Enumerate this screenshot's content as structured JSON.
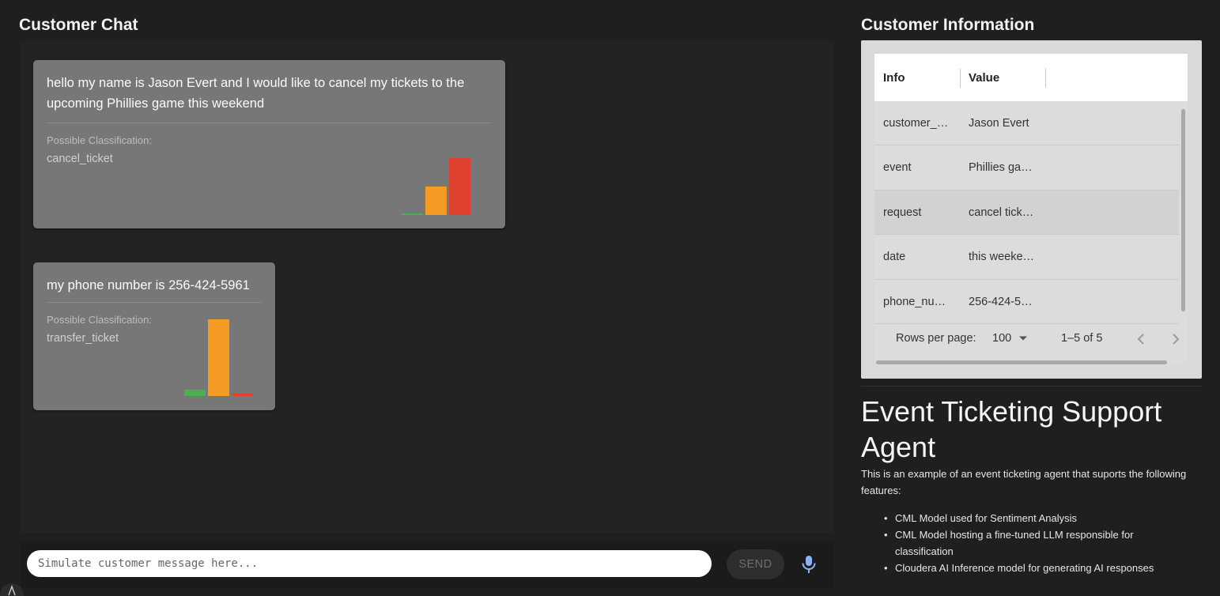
{
  "chat": {
    "title": "Customer Chat",
    "messages": [
      {
        "text": "hello my name is Jason Evert and I would like to cancel my tickets to the upcoming Phillies game this weekend",
        "classification_label": "Possible Classification:",
        "classification": "cancel_ticket",
        "sentiment": {
          "positive": 0.02,
          "neutral": 0.5,
          "negative": 1.0
        }
      },
      {
        "text": "my phone number is 256-424-5961",
        "classification_label": "Possible Classification:",
        "classification": "transfer_ticket",
        "sentiment": {
          "positive": 0.08,
          "neutral": 1.0,
          "negative": 0.03
        }
      }
    ],
    "composer": {
      "placeholder": "Simulate customer message here...",
      "send_label": "SEND",
      "mic_icon": "microphone-icon"
    }
  },
  "customer_info": {
    "title": "Customer Information",
    "columns": [
      "Info",
      "Value"
    ],
    "rows": [
      {
        "info": "customer_…",
        "value": "Jason Evert"
      },
      {
        "info": "event",
        "value": "Phillies ga…"
      },
      {
        "info": "request",
        "value": "cancel tick…"
      },
      {
        "info": "date",
        "value": "this weeke…"
      },
      {
        "info": "phone_nu…",
        "value": "256-424-5…"
      }
    ],
    "footer": {
      "rows_per_page_label": "Rows per page:",
      "rows_per_page_value": "100",
      "range": "1–5 of 5"
    }
  },
  "agent": {
    "title": "Event Ticketing Support Agent",
    "description": "This is an example of an event ticketing agent that suports the following features:",
    "features": [
      "CML Model used for Sentiment Analysis",
      "CML Model hosting a fine-tuned LLM responsible for classification",
      "Cloudera AI Inference model for generating AI responses"
    ]
  },
  "colors": {
    "positive": "#4caf50",
    "neutral": "#f59a23",
    "negative": "#e0422f"
  }
}
